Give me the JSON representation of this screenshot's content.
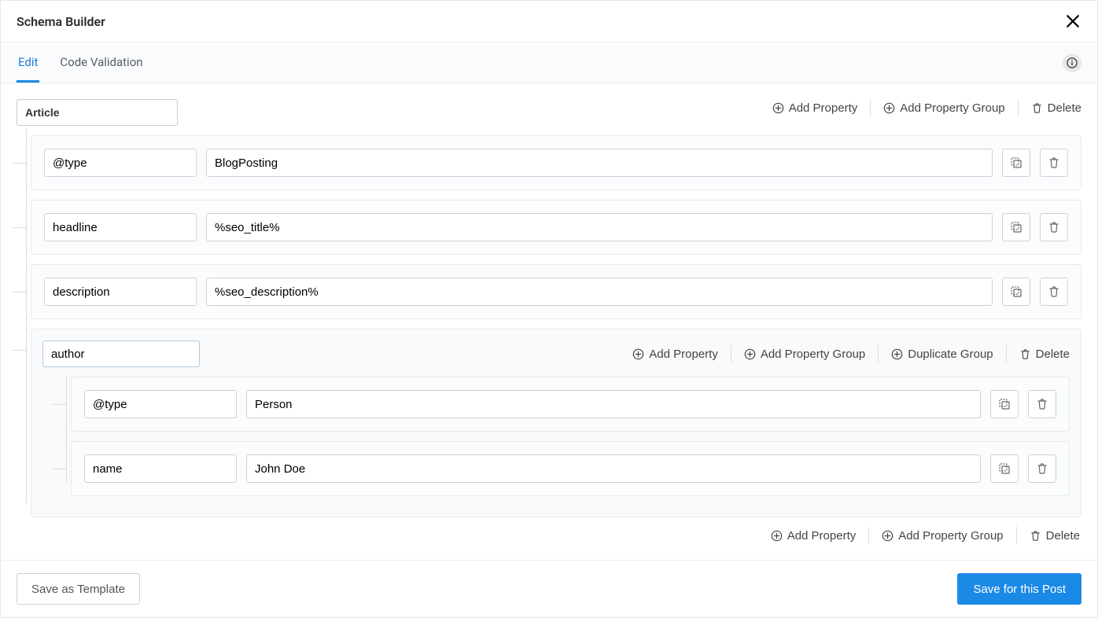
{
  "title": "Schema Builder",
  "tabs": {
    "edit": "Edit",
    "code": "Code Validation",
    "activeIndex": 0
  },
  "actions": {
    "addProperty": "Add Property",
    "addGroup": "Add Property Group",
    "duplicateGroup": "Duplicate Group",
    "delete": "Delete"
  },
  "footer": {
    "saveTemplate": "Save as Template",
    "savePost": "Save for this Post"
  },
  "schema": {
    "root": "Article",
    "props": [
      {
        "key": "@type",
        "value": "BlogPosting"
      },
      {
        "key": "headline",
        "value": "%seo_title%"
      },
      {
        "key": "description",
        "value": "%seo_description%"
      }
    ],
    "group": {
      "key": "author",
      "props": [
        {
          "key": "@type",
          "value": "Person"
        },
        {
          "key": "name",
          "value": "John Doe"
        }
      ]
    }
  }
}
